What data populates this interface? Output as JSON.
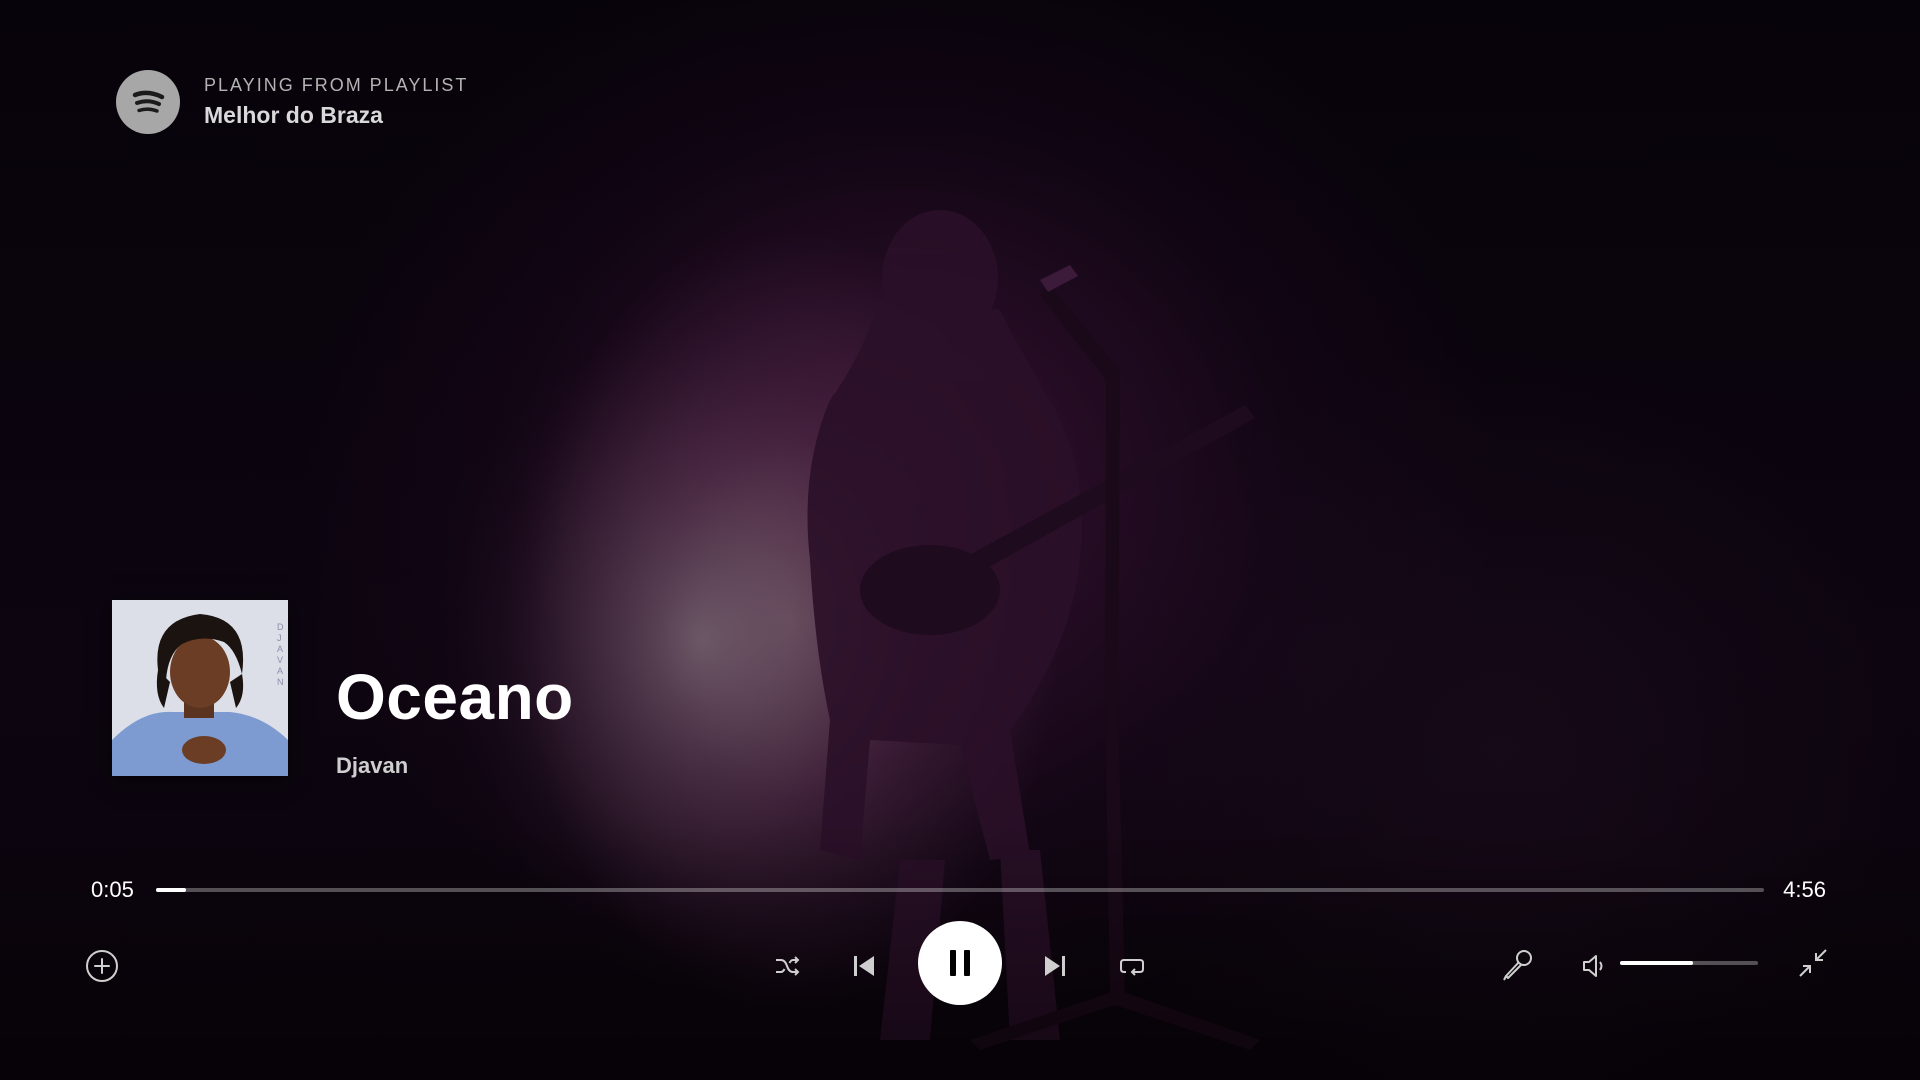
{
  "context": {
    "label": "PLAYING FROM PLAYLIST",
    "name": "Melhor do Braza"
  },
  "track": {
    "title": "Oceano",
    "artist": "Djavan",
    "cover_text": "DJAVAN"
  },
  "playback": {
    "current_time": "0:05",
    "total_time": "4:56",
    "progress_fraction": 0.017,
    "volume_fraction": 0.53,
    "state": "playing"
  },
  "icons": {
    "logo": "spotify-logo",
    "add": "add-circle-icon",
    "shuffle": "shuffle-icon",
    "previous": "skip-previous-icon",
    "pause": "pause-icon",
    "next": "skip-next-icon",
    "repeat": "repeat-icon",
    "lyrics": "microphone-icon",
    "volume": "volume-icon",
    "collapse": "minimize-icon"
  },
  "colors": {
    "accent": "#ffffff",
    "track_bg": "rgba(255,255,255,0.3)",
    "logo": "#a7a7a7"
  }
}
